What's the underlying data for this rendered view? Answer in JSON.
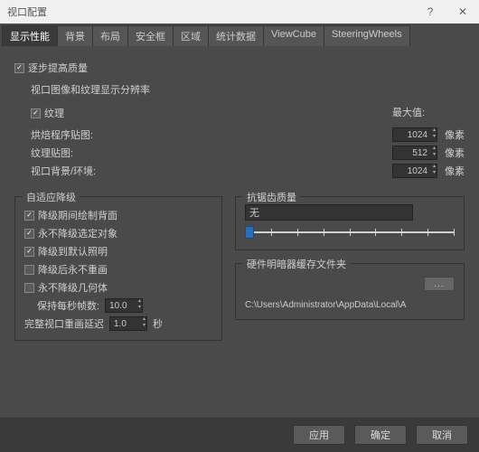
{
  "window": {
    "title": "视口配置"
  },
  "tabs": [
    "显示性能",
    "背景",
    "布局",
    "安全框",
    "区域",
    "统计数据",
    "ViewCube",
    "SteeringWheels"
  ],
  "active_tab": 0,
  "progressive": {
    "checkbox_label": "逐步提高质量",
    "section": "视口图像和纹理显示分辨率",
    "textures_label": "纹理",
    "max_label": "最大值:",
    "rows": [
      {
        "label": "烘焙程序贴图:",
        "value": "1024",
        "unit": "像素"
      },
      {
        "label": "纹理贴图:",
        "value": "512",
        "unit": "像素"
      },
      {
        "label": "视口背景/环境:",
        "value": "1024",
        "unit": "像素"
      }
    ]
  },
  "adaptive": {
    "legend": "自适应降级",
    "items": [
      {
        "label": "降级期间绘制背面",
        "checked": true
      },
      {
        "label": "永不降级选定对象",
        "checked": true
      },
      {
        "label": "降级到默认照明",
        "checked": true
      },
      {
        "label": "降级后永不重画",
        "checked": false
      },
      {
        "label": "永不降级几何体",
        "checked": false
      }
    ],
    "fps_label": "保持每秒帧数:",
    "fps_value": "10.0",
    "redraw_label": "完整视口重画延迟",
    "redraw_value": "1.0",
    "redraw_unit": "秒"
  },
  "antialias": {
    "legend": "抗锯齿质量",
    "value": "无"
  },
  "cache": {
    "legend": "硬件明暗器缓存文件夹",
    "browse": "...",
    "path": "C:\\Users\\Administrator\\AppData\\Local\\A"
  },
  "buttons": {
    "apply": "应用",
    "ok": "确定",
    "cancel": "取消"
  }
}
